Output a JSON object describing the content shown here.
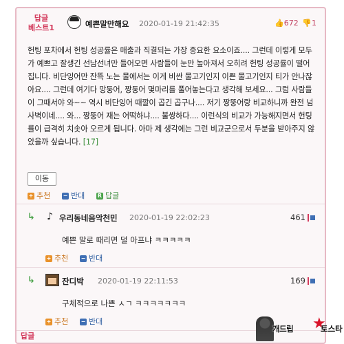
{
  "best_comment": {
    "label_line1": "답글",
    "label_line2": "베스트1",
    "nickname": "예쁜말만해요",
    "date": "2020-01-19 21:42:35",
    "up_count": "672",
    "down_count": "1",
    "body": "헌팅 포차에서 헌팅 성공률은 매출과 직결되는 가장 중요한 요소이죠.... 그런데 이렇게 모두가 예쁘고 잘생긴 선남선녀만 들어오면 사람들이 눈만 높아져서 오히려 헌팅 성공률이 떨어집니다. 비단잉어만 잔뜩 노는 물에서는 이게 비싼 물고기인지 이쁜 물고기인지 티가 안나잖아요.... 그런데 여기다 망둥어, 짱둥어 몇마리를 풀어놓는다고 생각해 보세요... 그럼 사람들이 그때서야 와~~ 역시 비단잉어 때깔이 곱긴 곱구나.... 저기 짱뚱어랑 비교하니까 완전 넘사벽이네.... 와... 짱뚱어 재는 어떡하냐.... 불쌍하다.... 이런식의 비교가 가능해지면서 헌팅률이 급격히 치솟아 오르게 됩니다. 아마 제 생각에는 그런 비교군으로서 두분을 받아주지 않았을까 싶습니다.",
    "ref": "[17]",
    "move_label": "이동",
    "up_label": "추천",
    "down_label": "반대",
    "reply_label": "답글"
  },
  "replies": [
    {
      "nickname": "우리동네음악천민",
      "date": "2020-01-19 22:02:23",
      "count": "461",
      "text": "예쁜 말로 때리면 덜 아프냐 ㅋㅋㅋㅋㅋ",
      "up_label": "추천",
      "down_label": "반대"
    },
    {
      "nickname": "잔디박",
      "date": "2020-01-19 22:11:53",
      "count": "169",
      "text": "구체적으로 나쁜 ㅅㄱ ㅋㅋㅋㅋㅋㅋㅋ",
      "up_label": "추천",
      "down_label": "반대"
    }
  ],
  "next_partial_label": "답글",
  "watermark": {
    "text1": "개드립",
    "text2": "토스타"
  },
  "colors": {
    "accent_pink": "#d33a5c",
    "border_pink": "#e7b9c5",
    "up_orange": "#e9922b",
    "down_blue": "#3f6fb4",
    "reply_green": "#4aa34a"
  }
}
